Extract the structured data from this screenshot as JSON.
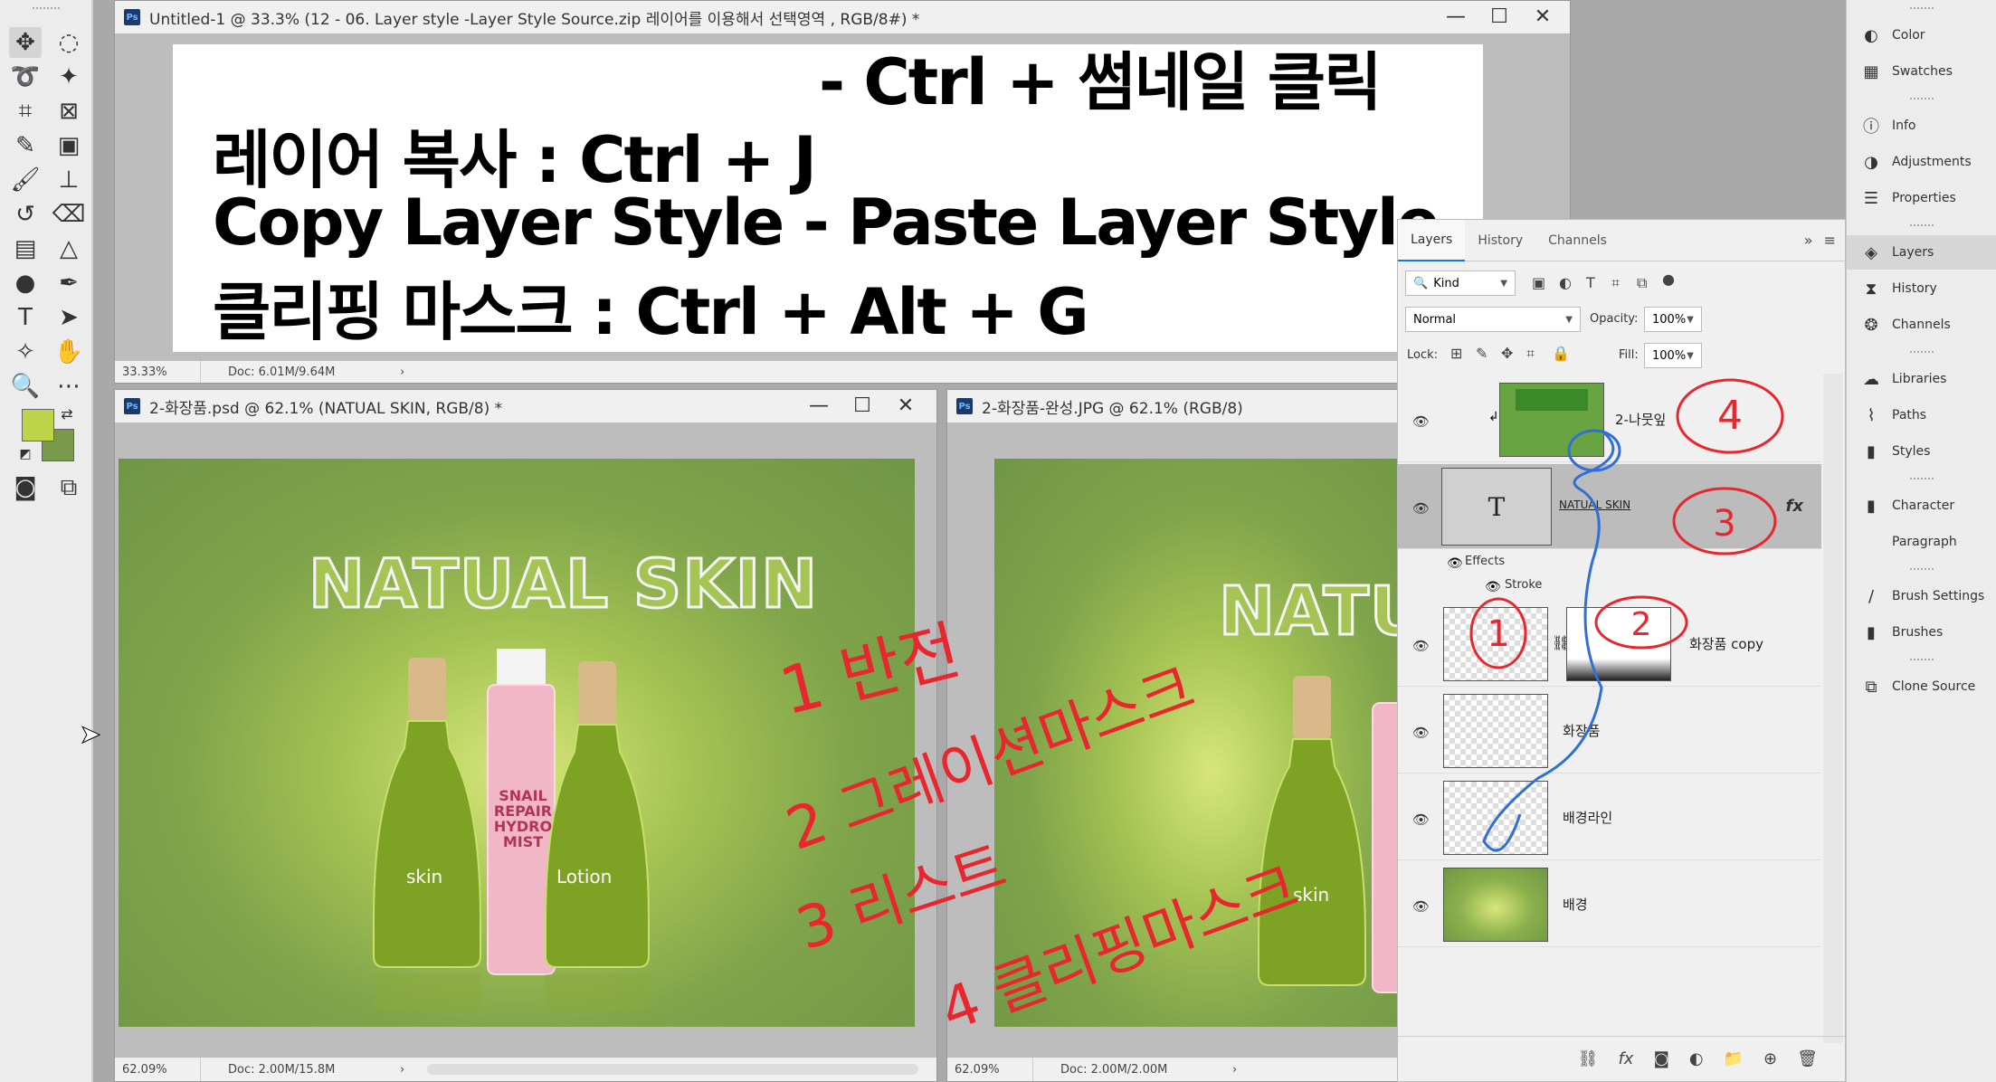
{
  "toolbar": {
    "tools": [
      "move-tool",
      "marquee-tool",
      "lasso-tool",
      "magic-wand-tool",
      "crop-tool",
      "frame-tool",
      "eyedropper-tool",
      "patch-tool",
      "brush-tool",
      "stamp-tool",
      "history-brush-tool",
      "eraser-tool",
      "gradient-tool",
      "blur-tool",
      "dodge-tool",
      "pen-tool",
      "type-tool",
      "path-select-tool",
      "shape-tool",
      "hand-tool",
      "zoom-tool",
      "more-tool"
    ],
    "foreground_color": "#bcd34a",
    "background_color": "#7a9a4b"
  },
  "doc1": {
    "title": "Untitled-1 @ 33.3% (12  - 06. Layer style  -Layer Style Source.zip  레이어를 이용해서 선택영역 , RGB/8#) *",
    "lines": [
      "- Ctrl + 썸네일 클릭",
      "레이어 복사 : Ctrl + J",
      "Copy Layer Style - Paste Layer Style",
      "클리핑 마스크 : Ctrl + Alt + G"
    ],
    "zoom": "33.33%",
    "doc_size": "Doc: 6.01M/9.64M"
  },
  "doc2": {
    "title": "2-화장품.psd @ 62.1% (NATUAL SKIN, RGB/8) *",
    "headline": "NATUAL SKIN",
    "bottle_left": "skin",
    "bottle_right": "Lotion",
    "bottle_center": "SNAIL\nREPAIR\nHYDRO\nMIST",
    "zoom": "62.09%",
    "doc_size": "Doc: 2.00M/15.8M"
  },
  "doc3": {
    "title": "2-화장품-완성.JPG @ 62.1% (RGB/8)",
    "headline": "NATUA",
    "bottle_left": "skin",
    "zoom": "62.09%",
    "doc_size": "Doc: 2.00M/2.00M"
  },
  "layers": {
    "tabs": [
      "Layers",
      "History",
      "Channels"
    ],
    "filter_kind": "Kind",
    "blend_mode": "Normal",
    "opacity_label": "Opacity:",
    "opacity": "100%",
    "lock_label": "Lock:",
    "fill_label": "Fill:",
    "fill": "100%",
    "items": [
      {
        "name": "2-나뭇잎"
      },
      {
        "name": "NATUAL SKIN"
      },
      {
        "name": "화장품 copy"
      },
      {
        "name": "화장품"
      },
      {
        "name": "배경라인"
      },
      {
        "name": "배경"
      }
    ],
    "effects_label": "Effects",
    "stroke_label": "Stroke"
  },
  "dock": {
    "items": [
      "Color",
      "Swatches",
      "Info",
      "Adjustments",
      "Properties",
      "Layers",
      "History",
      "Channels",
      "Libraries",
      "Paths",
      "Styles",
      "Character",
      "Paragraph",
      "Brush Settings",
      "Brushes",
      "Clone Source"
    ]
  },
  "annotations": {
    "circle_1": "1",
    "circle_2": "2",
    "circle_3": "3",
    "circle_4": "4",
    "note_1": "1 반전",
    "note_2": "2 그레이션마스크",
    "note_3": "3 리스트",
    "note_4": "4 클리핑마스크",
    "ink_color": "#e8262e",
    "line_color": "#2f6fd6"
  }
}
